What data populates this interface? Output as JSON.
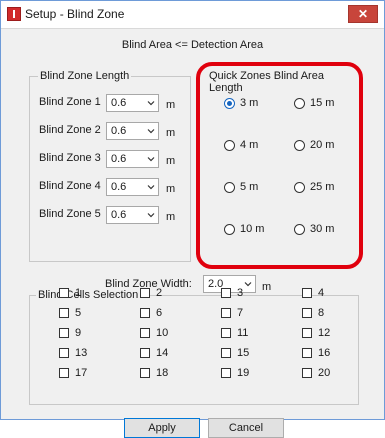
{
  "window": {
    "title": "Setup - Blind Zone",
    "close_glyph": "✕"
  },
  "subtitle": "Blind Area <= Detection Area",
  "blind_zone_length": {
    "group_label": "Blind Zone Length",
    "unit": "m",
    "rows": [
      {
        "label": "Blind Zone 1",
        "value": "0.6"
      },
      {
        "label": "Blind Zone 2",
        "value": "0.6"
      },
      {
        "label": "Blind Zone 3",
        "value": "0.6"
      },
      {
        "label": "Blind Zone 4",
        "value": "0.6"
      },
      {
        "label": "Blind Zone 5",
        "value": "0.6"
      }
    ]
  },
  "quick_zones": {
    "group_label": "Quick Zones Blind Area Length",
    "options": [
      {
        "label": "3 m",
        "checked": true
      },
      {
        "label": "15 m",
        "checked": false
      },
      {
        "label": "4 m",
        "checked": false
      },
      {
        "label": "20 m",
        "checked": false
      },
      {
        "label": "5 m",
        "checked": false
      },
      {
        "label": "25 m",
        "checked": false
      },
      {
        "label": "10 m",
        "checked": false
      },
      {
        "label": "30 m",
        "checked": false
      }
    ],
    "highlight_color": "#e0000d"
  },
  "width": {
    "label": "Blind Zone Width:",
    "value": "2.0",
    "unit": "m"
  },
  "cells": {
    "group_label": "Blind Cells Selection",
    "items": [
      "1",
      "2",
      "3",
      "4",
      "5",
      "6",
      "7",
      "8",
      "9",
      "10",
      "11",
      "12",
      "13",
      "14",
      "15",
      "16",
      "17",
      "18",
      "19",
      "20"
    ]
  },
  "buttons": {
    "apply": "Apply",
    "cancel": "Cancel"
  }
}
